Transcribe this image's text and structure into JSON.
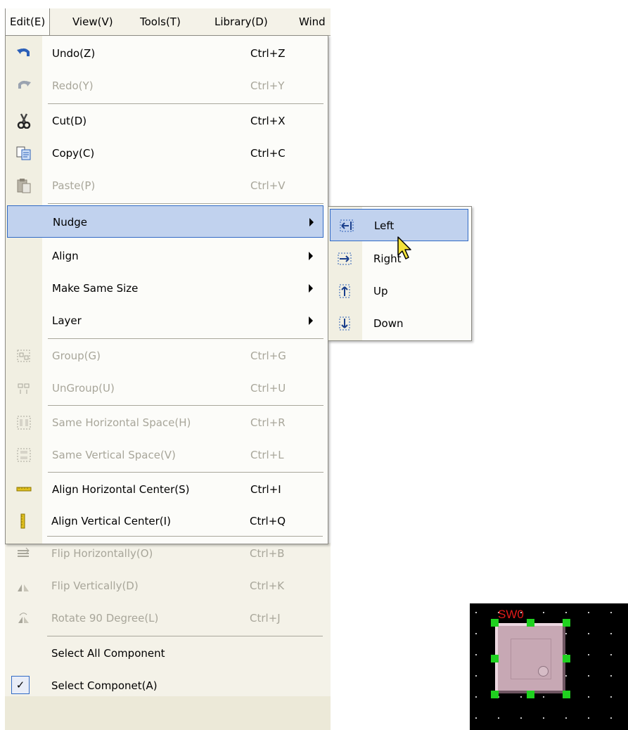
{
  "menubar": {
    "items": [
      "Edit(E)",
      "View(V)",
      "Tools(T)",
      "Library(D)",
      "Wind"
    ]
  },
  "edit_menu": {
    "items": [
      {
        "label": "Undo(Z)",
        "shortcut": "Ctrl+Z",
        "icon": "undo-icon"
      },
      {
        "label": "Redo(Y)",
        "shortcut": "Ctrl+Y",
        "icon": "redo-icon"
      },
      {
        "label": "Cut(D)",
        "shortcut": "Ctrl+X",
        "icon": "scissors-icon"
      },
      {
        "label": "Copy(C)",
        "shortcut": "Ctrl+C",
        "icon": "copy-icon"
      },
      {
        "label": "Paste(P)",
        "shortcut": "Ctrl+V",
        "icon": "paste-icon"
      },
      {
        "label": "Nudge",
        "shortcut": "",
        "submenu": true
      },
      {
        "label": "Align",
        "shortcut": "",
        "submenu": true
      },
      {
        "label": "Make Same Size",
        "shortcut": "",
        "submenu": true
      },
      {
        "label": "Layer",
        "shortcut": "",
        "submenu": true
      },
      {
        "label": "Group(G)",
        "shortcut": "Ctrl+G",
        "icon": "group-icon"
      },
      {
        "label": "UnGroup(U)",
        "shortcut": "Ctrl+U",
        "icon": "ungroup-icon"
      },
      {
        "label": "Same Horizontal Space(H)",
        "shortcut": "Ctrl+R",
        "icon": "horizontal-space-icon"
      },
      {
        "label": "Same Vertical Space(V)",
        "shortcut": "Ctrl+L",
        "icon": "vertical-space-icon"
      },
      {
        "label": "Align Horizontal Center(S)",
        "shortcut": "Ctrl+I",
        "icon": "align-horizontal-center-icon"
      },
      {
        "label": "Align Vertical Center(I)",
        "shortcut": "Ctrl+Q",
        "icon": "align-vertical-center-icon"
      },
      {
        "label": "Flip Horizontally(O)",
        "shortcut": "Ctrl+B",
        "icon": "flip-horizontal-icon"
      },
      {
        "label": "Flip Vertically(D)",
        "shortcut": "Ctrl+K",
        "icon": "flip-vertical-icon"
      },
      {
        "label": "Rotate 90 Degree(L)",
        "shortcut": "Ctrl+J",
        "icon": "rotate-icon"
      },
      {
        "label": "Select All Component",
        "shortcut": ""
      },
      {
        "label": "Select Componet(A)",
        "shortcut": "",
        "checked": true
      }
    ]
  },
  "nudge_submenu": {
    "items": [
      {
        "label": "Left",
        "icon": "nudge-left-icon"
      },
      {
        "label": "Right",
        "icon": "nudge-right-icon"
      },
      {
        "label": "Up",
        "icon": "nudge-up-icon"
      },
      {
        "label": "Down",
        "icon": "nudge-down-icon"
      }
    ]
  },
  "canvas": {
    "component_label": "SW0"
  },
  "colors": {
    "highlight": "#c1d2ee",
    "highlight_border": "#316ac5",
    "disabled_text": "#a8a69a",
    "component_label": "#e01a1a",
    "selection_handle": "#1fd11f"
  }
}
